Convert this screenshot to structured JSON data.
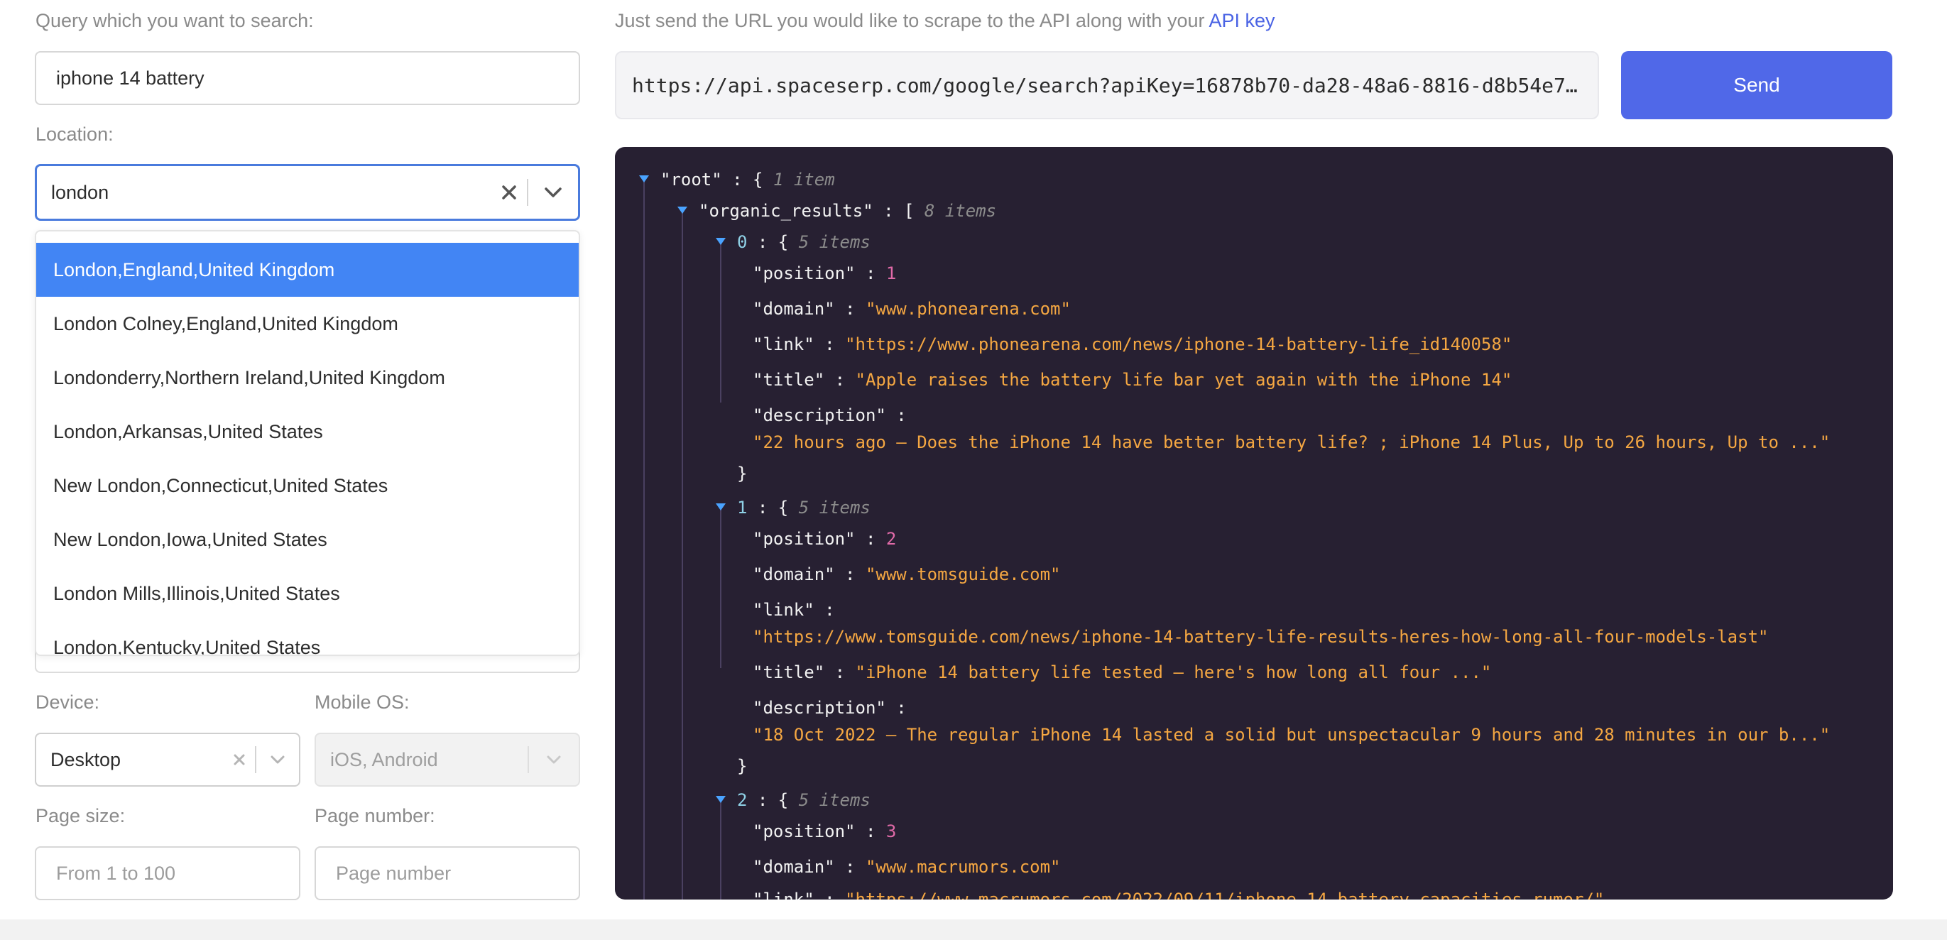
{
  "form": {
    "query_label": "Query which you want to search:",
    "query_value": "iphone 14 battery",
    "location_label": "Location:",
    "location_value": "london",
    "location_options": [
      "London,England,United Kingdom",
      "London Colney,England,United Kingdom",
      "Londonderry,Northern Ireland,United Kingdom",
      "London,Arkansas,United States",
      "New London,Connecticut,United States",
      "New London,Iowa,United States",
      "London Mills,Illinois,United States",
      "London,Kentucky,United States"
    ],
    "device_label": "Device:",
    "device_value": "Desktop",
    "mobile_os_label": "Mobile OS:",
    "mobile_os_value": "iOS, Android",
    "page_size_label": "Page size:",
    "page_size_placeholder": "From 1 to 100",
    "page_number_label": "Page number:",
    "page_number_placeholder": "Page number"
  },
  "api": {
    "hint_text": "Just send the URL you would like to scrape to the API along with your",
    "hint_link": "API key",
    "url": "https://api.spaceserp.com/google/search?apiKey=16878b70-da28-48a6-8816-d8b54e7…",
    "send_label": "Send"
  },
  "json_view": {
    "root_key": "\"root\"",
    "root_meta": "1 item",
    "organic_key": "\"organic_results\"",
    "organic_meta": "8 items",
    "items": [
      {
        "index": "0",
        "meta": "5 items",
        "position": "1",
        "domain": "\"www.phonearena.com\"",
        "link": "\"https://www.phonearena.com/news/iphone-14-battery-life_id140058\"",
        "title": "\"Apple raises the battery life bar yet again with the iPhone 14\"",
        "description": "\"22 hours ago — Does the iPhone 14 have better battery life? ; iPhone 14 Plus, Up to 26 hours, Up to ...\""
      },
      {
        "index": "1",
        "meta": "5 items",
        "position": "2",
        "domain": "\"www.tomsguide.com\"",
        "link": "\"https://www.tomsguide.com/news/iphone-14-battery-life-results-heres-how-long-all-four-models-last\"",
        "title": "\"iPhone 14 battery life tested — here's how long all four ...\"",
        "description": "\"18 Oct 2022 — The regular iPhone 14 lasted a solid but unspectacular 9 hours and 28 minutes in our b...\""
      },
      {
        "index": "2",
        "meta": "5 items",
        "position": "3",
        "domain": "\"www.macrumors.com\"",
        "link": "\"https://www.macrumors.com/2022/09/11/iphone-14-battery-capacities-rumor/\""
      }
    ],
    "keys": {
      "position": "\"position\"",
      "domain": "\"domain\"",
      "link": "\"link\"",
      "title": "\"title\"",
      "description": "\"description\""
    }
  },
  "colors": {
    "accent": "#5068e8",
    "option_active": "#4285f4",
    "json_bg": "#272032",
    "json_string": "#f5a742",
    "json_number": "#e06aa8"
  }
}
